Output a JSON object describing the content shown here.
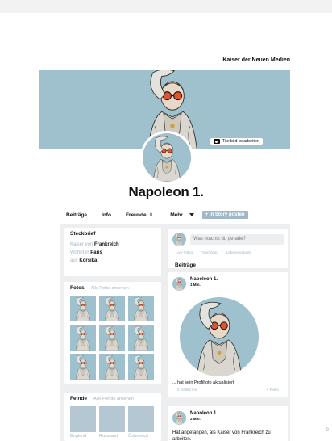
{
  "header": {
    "title": "Kaiser der Neuen Medien"
  },
  "cover": {
    "edit_label": "Titelbild bearbeiten",
    "icon": "camera-icon"
  },
  "profile": {
    "name": "Napoleon 1."
  },
  "tabs": [
    {
      "label": "Beiträge"
    },
    {
      "label": "Info"
    },
    {
      "label": "Freunde",
      "count": "0"
    },
    {
      "label": "Mehr",
      "icon": "caret-down-icon"
    }
  ],
  "story_button": "+ In Story posten",
  "steckbrief": {
    "title": "Steckbrief",
    "facts": [
      {
        "prefix": "Kaiser von",
        "value": "Frankreich"
      },
      {
        "prefix": "Wohnt in",
        "value": "Paris"
      },
      {
        "prefix": "aus",
        "value": "Korsika"
      }
    ]
  },
  "fotos": {
    "title": "Fotos",
    "link": "Alle Fotos ansehen"
  },
  "feinde": {
    "title": "Feinde",
    "link": "Alle Feinde ansehen",
    "items": [
      "England",
      "Russland",
      "Österreich"
    ]
  },
  "composer": {
    "placeholder": "Was machst du gerade?",
    "actions": [
      "Live-Video",
      "Foto/Video",
      "Lebensereignis"
    ]
  },
  "posts_label": "Beiträge",
  "posts": [
    {
      "author": "Napoleon 1.",
      "time": "1 Min.",
      "text": "... hat sein Profilfoto aktualisiert",
      "actions": [
        "0 Gefällt mir",
        "Teilen"
      ]
    },
    {
      "author": "Napoleon 1.",
      "time": "2 Min.",
      "text": "Hat angefangen, als Kaiser von Frankreich zu arbeiten."
    }
  ],
  "page_number": "9",
  "colors": {
    "accent": "#9fb7c6",
    "cover": "#9fc1cd",
    "background": "#eceef0"
  }
}
